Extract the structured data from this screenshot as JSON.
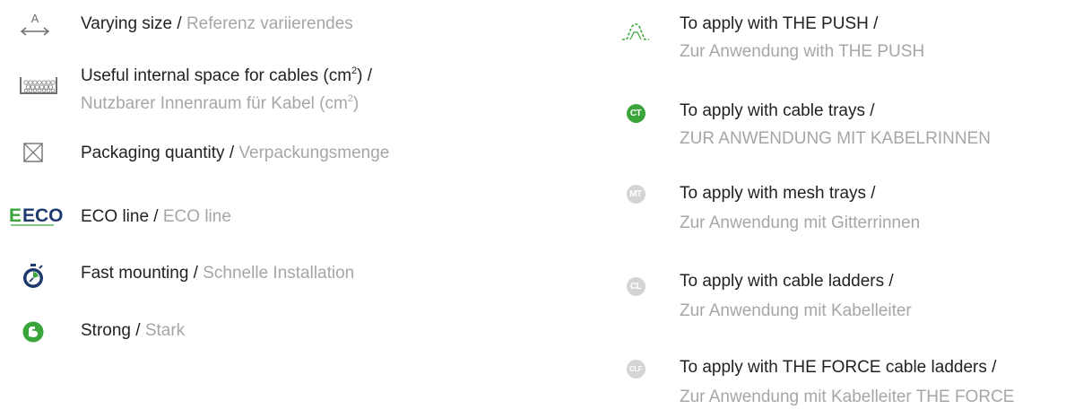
{
  "left": [
    {
      "en": "Varying size",
      "sep": " / ",
      "de": "Referenz variierendes",
      "icon": "varying-size-icon"
    },
    {
      "en_line1": "Useful internal space for cables (cm",
      "en_sup": "2",
      "en_line1_end": ") /",
      "de": "Nutzbarer Innenraum für Kabel (cm",
      "de_sup": "2",
      "de_end": ")",
      "icon": "cable-space-icon"
    },
    {
      "en": "Packaging quantity",
      "sep": " / ",
      "de": "Verpackungsmenge",
      "icon": "packaging-box-icon"
    },
    {
      "en": "ECO line",
      "sep": " / ",
      "de": "ECO line",
      "icon": "eco-logo-icon",
      "icon_text": "ECO"
    },
    {
      "en": "Fast mounting",
      "sep": " / ",
      "de": "Schnelle Installation",
      "icon": "stopwatch-icon"
    },
    {
      "en": "Strong",
      "sep": " / ",
      "de": "Stark",
      "icon": "strong-arm-icon"
    }
  ],
  "right": [
    {
      "en": "To apply with THE PUSH /",
      "de": "Zur Anwendung with THE PUSH",
      "icon": "the-push-icon"
    },
    {
      "en": "To apply with cable trays /",
      "de": "ZUR ANWENDUNG MIT KABELRINNEN",
      "icon": "ct-badge-icon",
      "badge": "CT"
    },
    {
      "en": "To apply with mesh trays /",
      "de": "Zur Anwendung mit Gitterrinnen",
      "icon": "mt-badge-icon",
      "badge": "MT"
    },
    {
      "en": "To apply with cable ladders /",
      "de": "Zur Anwendung mit Kabelleiter",
      "icon": "cl-badge-icon",
      "badge": "CL"
    },
    {
      "en": "To apply with THE FORCE cable ladders /",
      "de": "Zur Anwendung mit Kabelleiter THE FORCE",
      "icon": "clf-badge-icon",
      "badge": "CLF"
    }
  ],
  "colors": {
    "text": "#222222",
    "secondary_text": "#a6a6a6",
    "green": "#3aa53a",
    "navy": "#1f3a6e",
    "badge_grey": "#d4d4d4",
    "icon_grey": "#6f6f6f"
  }
}
